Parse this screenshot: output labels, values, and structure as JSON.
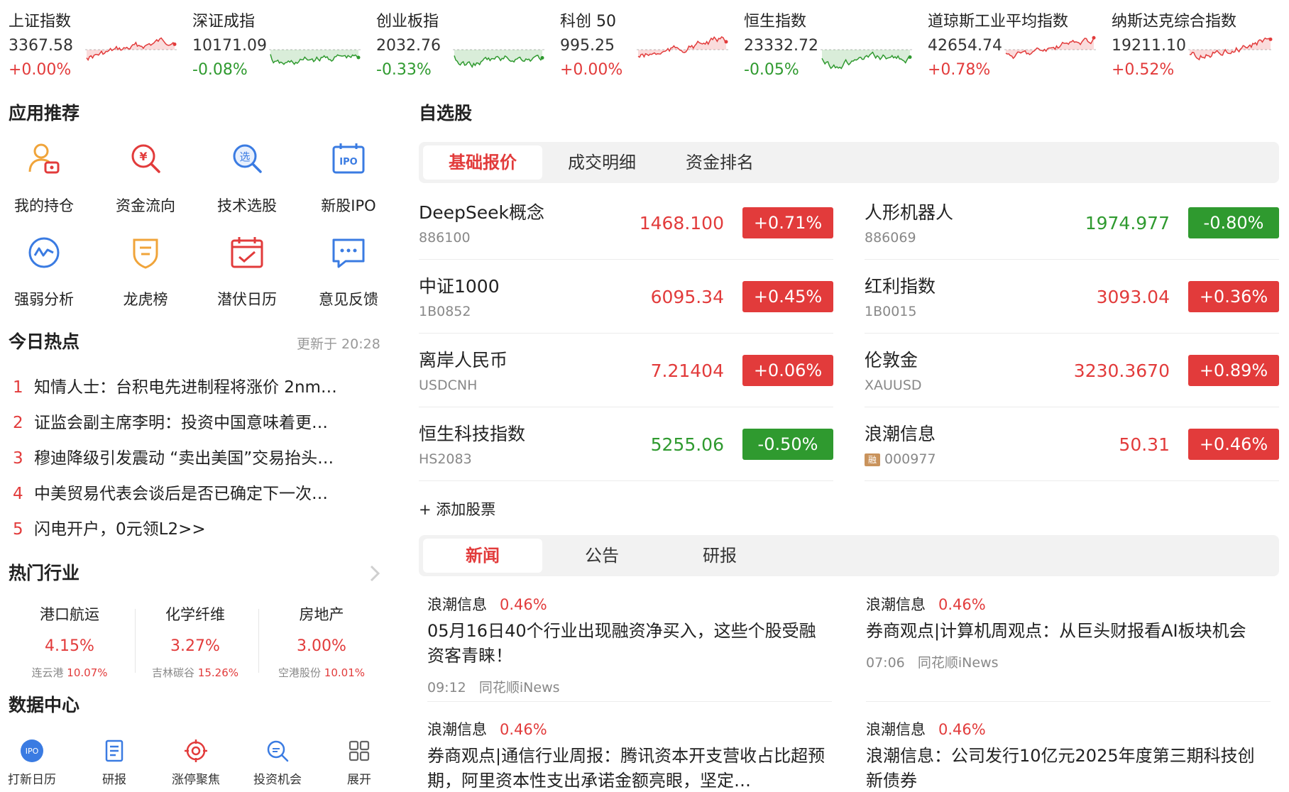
{
  "indices": [
    {
      "name": "上证指数",
      "value": "3367.58",
      "change": "+0.00%",
      "trend": "up"
    },
    {
      "name": "深证成指",
      "value": "10171.09",
      "change": "-0.08%",
      "trend": "down"
    },
    {
      "name": "创业板指",
      "value": "2032.76",
      "change": "-0.33%",
      "trend": "down"
    },
    {
      "name": "科创 50",
      "value": "995.25",
      "change": "+0.00%",
      "trend": "up"
    },
    {
      "name": "恒生指数",
      "value": "23332.72",
      "change": "-0.05%",
      "trend": "down"
    },
    {
      "name": "道琼斯工业平均指数",
      "value": "42654.74",
      "change": "+0.78%",
      "trend": "up"
    },
    {
      "name": "纳斯达克综合指数",
      "value": "19211.10",
      "change": "+0.52%",
      "trend": "up"
    }
  ],
  "apps": {
    "title": "应用推荐",
    "items": [
      {
        "label": "我的持仓",
        "icon": "portfolio-icon"
      },
      {
        "label": "资金流向",
        "icon": "money-flow-icon"
      },
      {
        "label": "技术选股",
        "icon": "stock-picker-icon"
      },
      {
        "label": "新股IPO",
        "icon": "ipo-icon"
      },
      {
        "label": "强弱分析",
        "icon": "strength-analysis-icon"
      },
      {
        "label": "龙虎榜",
        "icon": "dragon-tiger-icon"
      },
      {
        "label": "潜伏日历",
        "icon": "calendar-icon"
      },
      {
        "label": "意见反馈",
        "icon": "feedback-icon"
      }
    ]
  },
  "hot": {
    "title": "今日热点",
    "updated": "更新于 20:28",
    "items": [
      {
        "num": "1",
        "text": "知情人士：台积电先进制程将涨价 2nm…"
      },
      {
        "num": "2",
        "text": "证监会副主席李明：投资中国意味着更…"
      },
      {
        "num": "3",
        "text": "穆迪降级引发震动 “卖出美国”交易抬头…"
      },
      {
        "num": "4",
        "text": "中美贸易代表会谈后是否已确定下一次…"
      },
      {
        "num": "5",
        "text": "闪电开户，0元领L2>>"
      }
    ]
  },
  "industries": {
    "title": "热门行业",
    "items": [
      {
        "name": "港口航运",
        "pct": "4.15%",
        "leader": "连云港",
        "leader_pct": "10.07%"
      },
      {
        "name": "化学纤维",
        "pct": "3.27%",
        "leader": "吉林碳谷",
        "leader_pct": "15.26%"
      },
      {
        "name": "房地产",
        "pct": "3.00%",
        "leader": "空港股份",
        "leader_pct": "10.01%"
      }
    ]
  },
  "datacenter": {
    "title": "数据中心",
    "items": [
      {
        "label": "打新日历",
        "icon": "ipo-badge-icon",
        "badge": "IPO"
      },
      {
        "label": "研报",
        "icon": "report-icon"
      },
      {
        "label": "涨停聚焦",
        "icon": "target-icon"
      },
      {
        "label": "投资机会",
        "icon": "search-icon"
      },
      {
        "label": "展开",
        "icon": "grid-icon"
      }
    ]
  },
  "watchlist": {
    "title": "自选股",
    "tabs": [
      "基础报价",
      "成交明细",
      "资金排名"
    ],
    "stocks": [
      {
        "name": "DeepSeek概念",
        "code": "886100",
        "price": "1468.100",
        "change": "+0.71%",
        "dir": "up",
        "margin": false
      },
      {
        "name": "人形机器人",
        "code": "886069",
        "price": "1974.977",
        "change": "-0.80%",
        "dir": "down",
        "margin": false
      },
      {
        "name": "中证1000",
        "code": "1B0852",
        "price": "6095.34",
        "change": "+0.45%",
        "dir": "up",
        "margin": false
      },
      {
        "name": "红利指数",
        "code": "1B0015",
        "price": "3093.04",
        "change": "+0.36%",
        "dir": "up",
        "margin": false
      },
      {
        "name": "离岸人民币",
        "code": "USDCNH",
        "price": "7.21404",
        "change": "+0.06%",
        "dir": "up",
        "margin": false
      },
      {
        "name": "伦敦金",
        "code": "XAUUSD",
        "price": "3230.3670",
        "change": "+0.89%",
        "dir": "up",
        "margin": false
      },
      {
        "name": "恒生科技指数",
        "code": "HS2083",
        "price": "5255.06",
        "change": "-0.50%",
        "dir": "down",
        "margin": false
      },
      {
        "name": "浪潮信息",
        "code": "000977",
        "price": "50.31",
        "change": "+0.46%",
        "dir": "up",
        "margin": true,
        "margin_label": "融"
      }
    ],
    "add_label": "+ 添加股票"
  },
  "news": {
    "tabs": [
      "新闻",
      "公告",
      "研报"
    ],
    "items": [
      {
        "stock": "浪潮信息",
        "pct": "0.46%",
        "title": "05月16日40个行业出现融资净买入，这些个股受融资客青睐！",
        "time": "09:12",
        "source": "同花顺iNews"
      },
      {
        "stock": "浪潮信息",
        "pct": "0.46%",
        "title": "券商观点|计算机周观点：从巨头财报看AI板块机会",
        "time": "07:06",
        "source": "同花顺iNews"
      },
      {
        "stock": "浪潮信息",
        "pct": "0.46%",
        "title": "券商观点|通信行业周报：腾讯资本开支营收占比超预期，阿里资本性支出承诺金额亮眼，坚定…",
        "time": "",
        "source": ""
      },
      {
        "stock": "浪潮信息",
        "pct": "0.46%",
        "title": "浪潮信息：公司发行10亿元2025年度第三期科技创新债券",
        "time": "",
        "source": ""
      }
    ]
  },
  "colors": {
    "up": "#e23b3b",
    "down": "#2f9a2f",
    "tab_bg": "#f2f2f2"
  }
}
